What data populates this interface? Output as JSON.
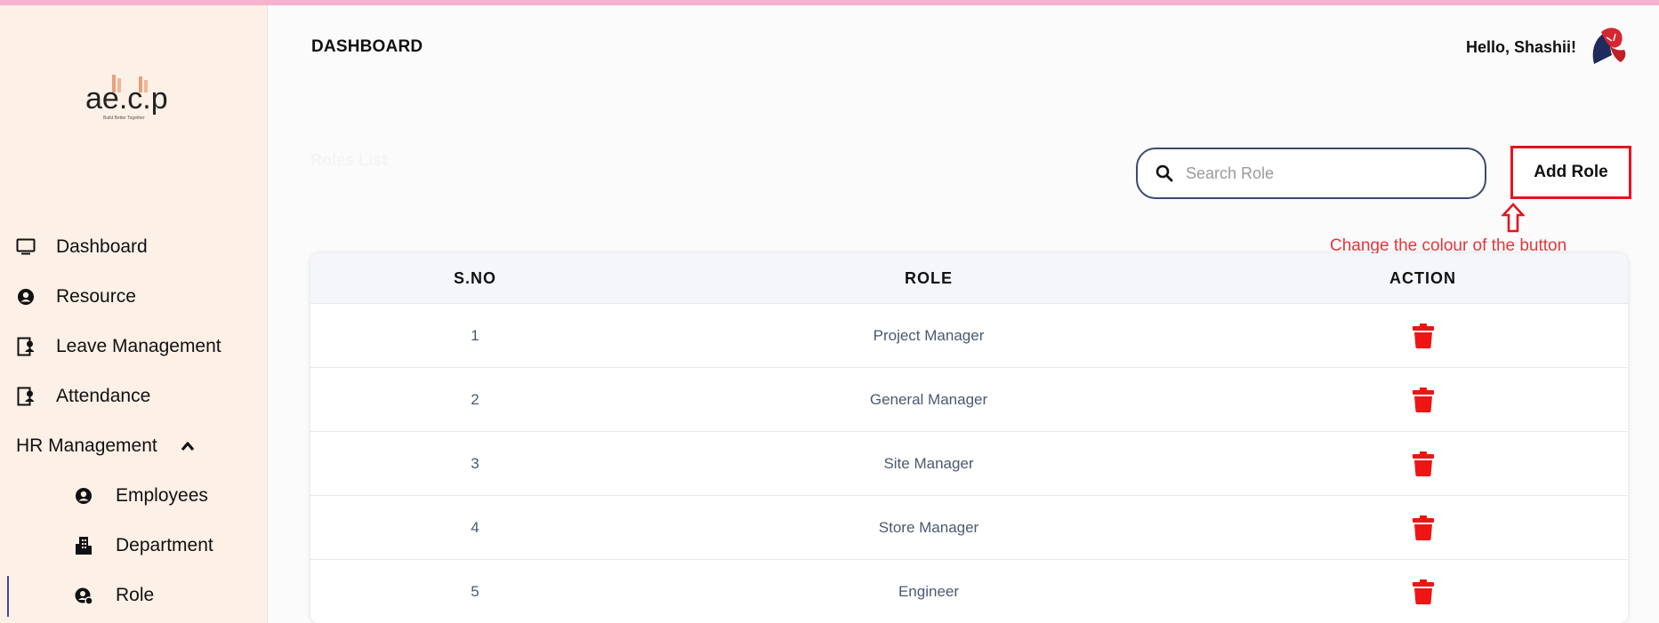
{
  "header": {
    "title": "DASHBOARD",
    "greeting": "Hello, Shashii!"
  },
  "logo": {
    "text": "ae.c.p",
    "tagline": "Build Better Together"
  },
  "sidebar": {
    "items": [
      {
        "label": "Dashboard",
        "icon": "monitor-icon"
      },
      {
        "label": "Resource",
        "icon": "user-circle-icon"
      },
      {
        "label": "Leave Management",
        "icon": "user-badge-icon"
      },
      {
        "label": "Attendance",
        "icon": "user-badge-icon"
      },
      {
        "label": "HR Management",
        "icon": "chevron-up-icon"
      },
      {
        "label": "Employees",
        "icon": "user-circle-icon"
      },
      {
        "label": "Department",
        "icon": "building-icon"
      },
      {
        "label": "Role",
        "icon": "role-icon"
      }
    ]
  },
  "section": {
    "title": "Roles List"
  },
  "search": {
    "placeholder": "Search Role",
    "value": ""
  },
  "toolbar": {
    "add_label": "Add Role"
  },
  "annotation": {
    "text": "Change the colour of the button"
  },
  "table": {
    "columns": [
      "S.NO",
      "ROLE",
      "ACTION"
    ],
    "rows": [
      {
        "sno": "1",
        "role": "Project Manager"
      },
      {
        "sno": "2",
        "role": "General Manager"
      },
      {
        "sno": "3",
        "role": "Site Manager"
      },
      {
        "sno": "4",
        "role": "Store Manager"
      },
      {
        "sno": "5",
        "role": "Engineer"
      }
    ]
  },
  "colors": {
    "sidebar_bg": "#fcf0e7",
    "delete": "#f01414",
    "annotation": "#e8353c",
    "accent": "#3949ab"
  }
}
